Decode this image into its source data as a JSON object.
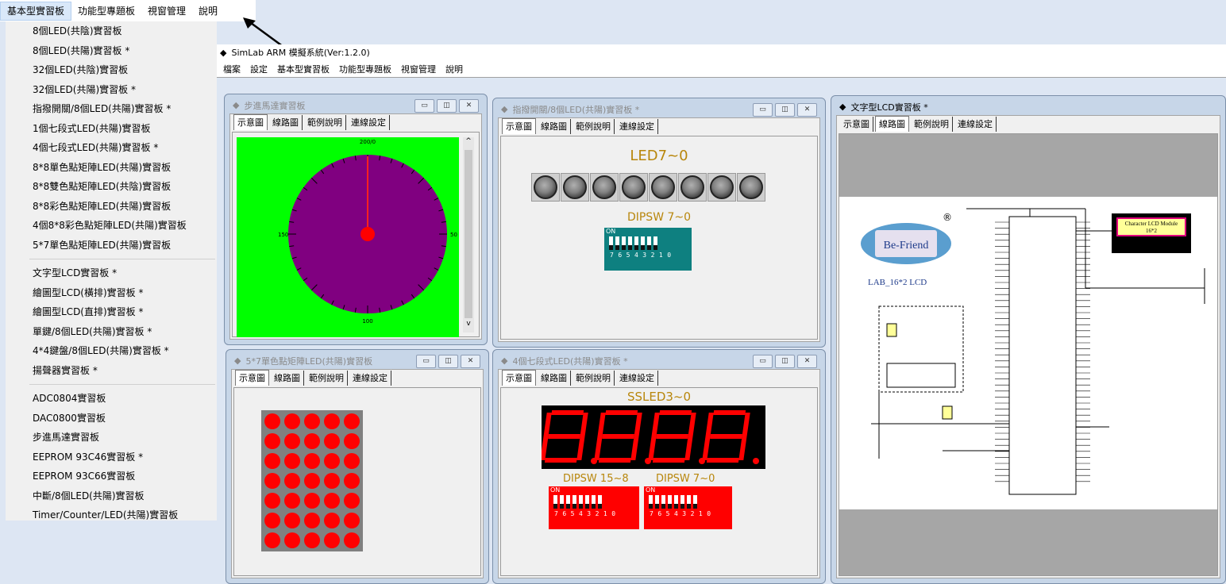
{
  "top_menu": [
    "基本型實習板",
    "功能型專題板",
    "視窗管理",
    "說明"
  ],
  "dropdown": {
    "group1": [
      "8個LED(共陰)實習板",
      "8個LED(共陽)實習板 *",
      "32個LED(共陰)實習板",
      "32個LED(共陽)實習板 *",
      "指撥開關/8個LED(共陽)實習板 *",
      "1個七段式LED(共陽)實習板",
      "4個七段式LED(共陽)實習板 *",
      "8*8單色點矩陣LED(共陽)實習板",
      "8*8雙色點矩陣LED(共陰)實習板",
      "8*8彩色點矩陣LED(共陽)實習板",
      "4個8*8彩色點矩陣LED(共陽)實習板",
      "5*7單色點矩陣LED(共陽)實習板"
    ],
    "group2": [
      "文字型LCD實習板 *",
      "繪圖型LCD(橫排)實習板 *",
      "繪圖型LCD(直排)實習板 *",
      "單鍵/8個LED(共陽)實習板 *",
      "4*4鍵盤/8個LED(共陽)實習板 *",
      "揚聲器實習板 *"
    ],
    "group3": [
      "ADC0804實習板",
      "DAC0800實習板",
      "步進馬達實習板",
      "EEPROM 93C46實習板 *",
      "EEPROM 93C66實習板",
      "中斷/8個LED(共陽)實習板",
      "Timer/Counter/LED(共陽)實習板"
    ]
  },
  "app": {
    "title": "SimLab ARM 模擬系統(Ver:1.2.0)",
    "menu": [
      "檔案",
      "設定",
      "基本型實習板",
      "功能型專題板",
      "視窗管理",
      "說明"
    ]
  },
  "tabs": [
    "示意圖",
    "線路圖",
    "範例說明",
    "連線設定"
  ],
  "windows": {
    "stepper": {
      "title": "步進馬達實習板",
      "dial_top": "200/0",
      "dial_left": "150",
      "dial_right": "50",
      "dial_bottom": "100"
    },
    "dipled": {
      "title": "指撥開關/8個LED(共陽)實習板 *",
      "led_label": "LED7~0",
      "dip_label": "DIPSW 7~0",
      "dip_on": "ON",
      "dip_nums": "76543210"
    },
    "lcd": {
      "title": "文字型LCD實習板 *",
      "brand": "Be-Friend",
      "registered": "®",
      "caption": "LAB_16*2 LCD",
      "module_title": "Character LCD Module",
      "module_sub": "16*2"
    },
    "matrix": {
      "title": "5*7單色點矩陣LED(共陽)實習板"
    },
    "sevenseg": {
      "title": "4個七段式LED(共陽)實習板 *",
      "label": "SSLED3~0",
      "dip1": "DIPSW 15~8",
      "dip2": "DIPSW 7~0",
      "dip_on": "ON",
      "dip_nums": "76543210"
    }
  },
  "colors": {
    "dial_bg": "#00ff00",
    "dial": "#800080",
    "led_red": "#ff0000",
    "dip_teal": "#0e8080",
    "dip_red": "#ff0000"
  },
  "window_buttons": [
    "minimize-icon",
    "restore-icon",
    "close-icon"
  ]
}
